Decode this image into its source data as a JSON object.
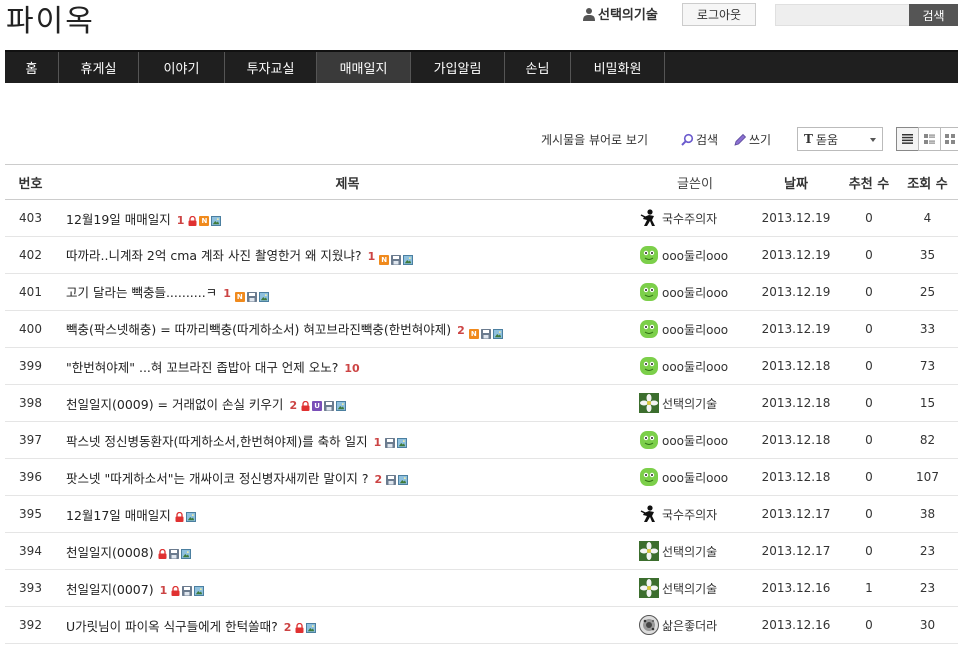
{
  "site": {
    "logo": "파이옥"
  },
  "header": {
    "username": "선택의기술",
    "logout_label": "로그아웃",
    "search_button": "검색",
    "search_value": ""
  },
  "nav": [
    "홈",
    "휴게실",
    "이야기",
    "투자교실",
    "매매일지",
    "가입알림",
    "손님",
    "비밀화원"
  ],
  "nav_active": "매매일지",
  "toolbar": {
    "viewer_link": "게시물을 뷰어로 보기",
    "search": "검색",
    "write": "쓰기",
    "font_icon": "T",
    "font_value": "돋움"
  },
  "table": {
    "headers": {
      "no": "번호",
      "title": "제목",
      "author": "글쓴이",
      "date": "날짜",
      "recommend": "추천 수",
      "views": "조회 수"
    },
    "rows": [
      {
        "no": "403",
        "title": "12월19일 매매일지",
        "count": "1",
        "badges": [
          "lock",
          "n",
          "img"
        ],
        "author": "국수주의자",
        "avatar": "ninja",
        "date": "2013.12.19",
        "rec": "0",
        "views": "4"
      },
      {
        "no": "402",
        "title": "따까라..니계좌 2억 cma 계좌 사진 촬영한거 왜 지웠냐?",
        "count": "1",
        "badges": [
          "n",
          "save",
          "img"
        ],
        "author": "ooo둘리ooo",
        "avatar": "dooly",
        "date": "2013.12.19",
        "rec": "0",
        "views": "35"
      },
      {
        "no": "401",
        "title": "고기 달라는 빽충들..........ㅋ",
        "count": "1",
        "badges": [
          "n",
          "save",
          "img"
        ],
        "author": "ooo둘리ooo",
        "avatar": "dooly",
        "date": "2013.12.19",
        "rec": "0",
        "views": "25"
      },
      {
        "no": "400",
        "title": "빽충(팍스넷해충) = 따까리빽충(따게하소서) 혀꼬브라진빽충(한번혀야제)",
        "count": "2",
        "badges": [
          "n",
          "save",
          "img"
        ],
        "author": "ooo둘리ooo",
        "avatar": "dooly",
        "date": "2013.12.19",
        "rec": "0",
        "views": "33"
      },
      {
        "no": "399",
        "title": "\"한번혀야제\" ...혀 꼬브라진 좁밥아 대구 언제 오노?",
        "count": "10",
        "badges": [],
        "author": "ooo둘리ooo",
        "avatar": "dooly",
        "date": "2013.12.18",
        "rec": "0",
        "views": "73"
      },
      {
        "no": "398",
        "title": "천일일지(0009) = 거래없이 손실 키우기",
        "count": "2",
        "badges": [
          "lock",
          "u",
          "save",
          "img"
        ],
        "author": "선택의기술",
        "avatar": "flower",
        "date": "2013.12.18",
        "rec": "0",
        "views": "15"
      },
      {
        "no": "397",
        "title": "팍스넷 정신병동환자(따게하소서,한번혀야제)를 축하 일지",
        "count": "1",
        "badges": [
          "save",
          "img"
        ],
        "author": "ooo둘리ooo",
        "avatar": "dooly",
        "date": "2013.12.18",
        "rec": "0",
        "views": "82"
      },
      {
        "no": "396",
        "title": "팟스넷 \"따게하소서\"는 개싸이코 정신병자새끼란 말이지 ?",
        "count": "2",
        "badges": [
          "save",
          "img"
        ],
        "author": "ooo둘리ooo",
        "avatar": "dooly",
        "date": "2013.12.18",
        "rec": "0",
        "views": "107"
      },
      {
        "no": "395",
        "title": "12월17일 매매일지",
        "count": "",
        "badges": [
          "lock",
          "img"
        ],
        "author": "국수주의자",
        "avatar": "ninja",
        "date": "2013.12.17",
        "rec": "0",
        "views": "38"
      },
      {
        "no": "394",
        "title": "천일일지(0008)",
        "count": "",
        "badges": [
          "lock",
          "save",
          "img"
        ],
        "author": "선택의기술",
        "avatar": "flower",
        "date": "2013.12.17",
        "rec": "0",
        "views": "23"
      },
      {
        "no": "393",
        "title": "천일일지(0007)",
        "count": "1",
        "badges": [
          "lock",
          "save",
          "img"
        ],
        "author": "선택의기술",
        "avatar": "flower",
        "date": "2013.12.16",
        "rec": "1",
        "views": "23"
      },
      {
        "no": "392",
        "title": "U가릿님이 파이옥 식구들에게 한턱쏠때?",
        "count": "2",
        "badges": [
          "lock",
          "img"
        ],
        "author": "삶은좋더라",
        "avatar": "mosaic",
        "date": "2013.12.16",
        "rec": "0",
        "views": "30"
      }
    ]
  }
}
